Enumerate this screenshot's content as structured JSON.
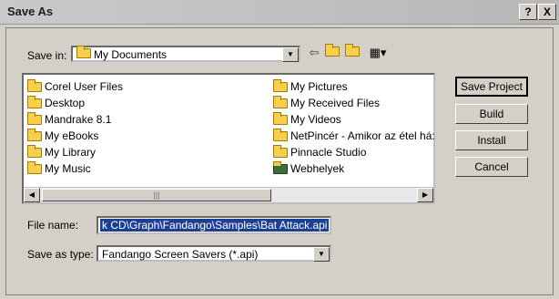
{
  "window": {
    "title": "Save As",
    "help_label": "?",
    "close_label": "X"
  },
  "save_in": {
    "label": "Save in:",
    "value": "My Documents"
  },
  "files": {
    "left": [
      "Corel User Files",
      "Desktop",
      "Mandrake 8.1",
      "My eBooks",
      "My Library",
      "My Music"
    ],
    "right": [
      "My Pictures",
      "My Received Files",
      "My Videos",
      "NetPincér - Amikor az étel há:",
      "Pinnacle Studio",
      "Webhelyek"
    ]
  },
  "buttons": {
    "save_project": "Save Project",
    "build": "Build",
    "install": "Install",
    "cancel": "Cancel"
  },
  "file_name": {
    "label": "File name:",
    "value": "k CD\\Graph\\Fandango\\Samples\\Bat Attack.api"
  },
  "save_as_type": {
    "label": "Save as type:",
    "value": "Fandango Screen Savers (*.api)"
  },
  "icons": {
    "back": "back-arrow-icon",
    "up": "up-folder-icon",
    "new_folder": "new-folder-icon",
    "views": "view-menu-icon"
  }
}
